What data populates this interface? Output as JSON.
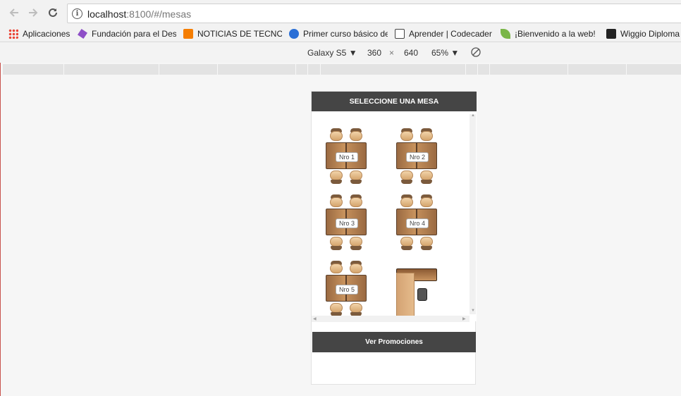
{
  "browser": {
    "url_host": "localhost",
    "url_rest": ":8100/#/mesas",
    "bookmarks": [
      {
        "label": "Aplicaciones",
        "color": "#4285f4"
      },
      {
        "label": "Fundación para el Des",
        "color": "#8e4fc7"
      },
      {
        "label": "NOTICIAS DE TECNOL",
        "color": "#f57d00"
      },
      {
        "label": "Primer curso básico de",
        "color": "#2a6fd6"
      },
      {
        "label": "Aprender | Codecader",
        "color": "#444444"
      },
      {
        "label": "¡Bienvenido a la web!",
        "color": "#7ab648"
      },
      {
        "label": "Wiggio Diploma",
        "color": "#222222"
      }
    ]
  },
  "device_toolbar": {
    "device": "Galaxy S5",
    "width": "360",
    "times": "×",
    "height": "640",
    "zoom": "65%"
  },
  "app": {
    "title": "SELECCIONE UNA MESA",
    "tables": [
      {
        "label": "Nro 1"
      },
      {
        "label": "Nro 2"
      },
      {
        "label": "Nro 3"
      },
      {
        "label": "Nro 4"
      },
      {
        "label": "Nro 5"
      }
    ],
    "promo_button": "Ver Promociones"
  }
}
